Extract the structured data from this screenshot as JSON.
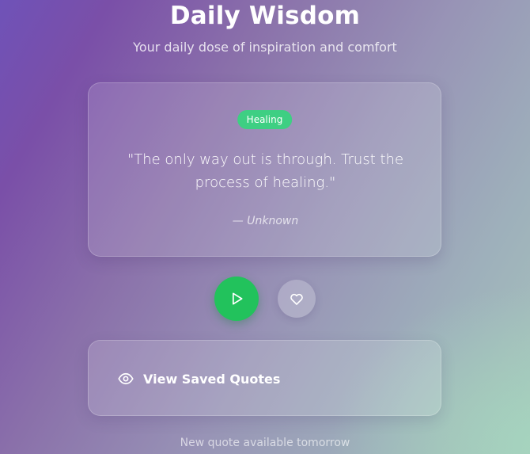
{
  "header": {
    "title": "Daily Wisdom",
    "subtitle": "Your daily dose of inspiration and comfort"
  },
  "quote": {
    "category": "Healing",
    "text": "\"The only way out is through. Trust the process of healing.\"",
    "author": "— Unknown"
  },
  "controls": {
    "play_icon": "play-icon",
    "favorite_icon": "heart-icon"
  },
  "saved": {
    "icon": "eye-icon",
    "label": "View Saved Quotes"
  },
  "footer": {
    "note": "New quote available tomorrow"
  },
  "colors": {
    "accent_green": "#22c25c",
    "badge_green": "#3ecf83",
    "bg_purple": "#7a4fa8",
    "bg_mint": "#a7c4bc"
  }
}
